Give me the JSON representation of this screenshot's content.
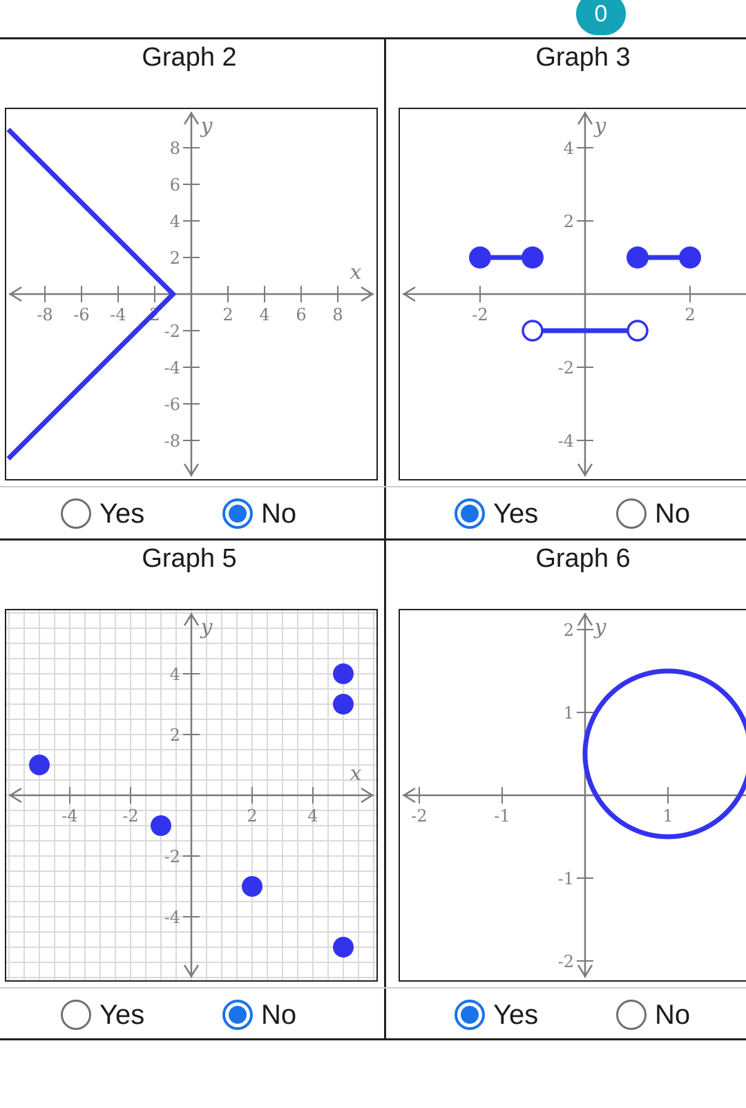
{
  "badge": {
    "value": "0"
  },
  "options": {
    "yes": "Yes",
    "no": "No"
  },
  "colors": {
    "curve": "#3333ee",
    "axis": "#7a7a7a",
    "grid": "#dadada",
    "selected": "#1a73e8",
    "badge": "#14a3b8"
  },
  "icons": {
    "radio_selected": "radio-checked-icon",
    "radio_unselected": "radio-unchecked-icon"
  },
  "graphs": [
    {
      "title": "Graph 2",
      "selected": "no"
    },
    {
      "title": "Graph 3",
      "selected": "yes"
    },
    {
      "title": "Graph 5",
      "selected": "no"
    },
    {
      "title": "Graph 6",
      "selected": "yes"
    }
  ],
  "chart_data": [
    {
      "type": "line",
      "title": "Graph 2",
      "xlabel": "x",
      "ylabel": "y",
      "xlim": [
        -10,
        10
      ],
      "ylim": [
        -10,
        10
      ],
      "xticks": [
        -8,
        -6,
        -4,
        -2,
        2,
        4,
        6,
        8
      ],
      "xtick_labels": [
        "-8",
        "-6",
        "-4",
        "2",
        "2",
        "4",
        "6",
        "8"
      ],
      "yticks": [
        8,
        6,
        4,
        2,
        -2,
        -4,
        -6,
        -8
      ],
      "ytick_labels": [
        "8",
        "6",
        "4",
        "2",
        "-2",
        "-4",
        "-6",
        "-8"
      ],
      "grid": false,
      "series": [
        {
          "x": [
            -10,
            -1,
            -10
          ],
          "y": [
            9,
            0,
            -9
          ]
        }
      ]
    },
    {
      "type": "line",
      "title": "Graph 3",
      "xlabel": "",
      "ylabel": "y",
      "xlim": [
        -3,
        3
      ],
      "ylim": [
        -5,
        5
      ],
      "xticks": [
        -2,
        2
      ],
      "xtick_labels": [
        "-2",
        "2"
      ],
      "yticks": [
        4,
        2,
        -2,
        -4
      ],
      "ytick_labels": [
        "4",
        "2",
        "-2",
        "-4"
      ],
      "grid": false,
      "segments": [
        {
          "x": [
            -2,
            -1
          ],
          "y": [
            1,
            1
          ],
          "start_closed": true,
          "end_closed": true
        },
        {
          "x": [
            1,
            2
          ],
          "y": [
            1,
            1
          ],
          "start_closed": true,
          "end_closed": true
        },
        {
          "x": [
            -1,
            1
          ],
          "y": [
            -1,
            -1
          ],
          "start_closed": false,
          "end_closed": false
        }
      ]
    },
    {
      "type": "scatter",
      "title": "Graph 5",
      "xlabel": "x",
      "ylabel": "y",
      "xlim": [
        -6,
        6
      ],
      "ylim": [
        -6,
        6
      ],
      "xticks": [
        -4,
        -2,
        2,
        4
      ],
      "xtick_labels": [
        "-4",
        "-2",
        "2",
        "4"
      ],
      "yticks": [
        4,
        2,
        -2,
        -4
      ],
      "ytick_labels": [
        "4",
        "2",
        "-2",
        "-4"
      ],
      "grid": true,
      "points": [
        {
          "x": -5,
          "y": 1
        },
        {
          "x": -1,
          "y": -1
        },
        {
          "x": 2,
          "y": -3
        },
        {
          "x": 5,
          "y": 4
        },
        {
          "x": 5,
          "y": 3
        },
        {
          "x": 5,
          "y": -5
        }
      ]
    },
    {
      "type": "line",
      "title": "Graph 6",
      "xlabel": "",
      "ylabel": "y",
      "xlim": [
        -2.2,
        2.2
      ],
      "ylim": [
        -2.2,
        2.2
      ],
      "xticks": [
        -2,
        -1,
        1
      ],
      "xtick_labels": [
        "-2",
        "-1",
        "1"
      ],
      "yticks": [
        2,
        1,
        -1,
        -2
      ],
      "ytick_labels": [
        "2",
        "1",
        "-1",
        "-2"
      ],
      "grid": false,
      "circle": {
        "cx": 1,
        "cy": 0.5,
        "r": 1
      }
    }
  ]
}
